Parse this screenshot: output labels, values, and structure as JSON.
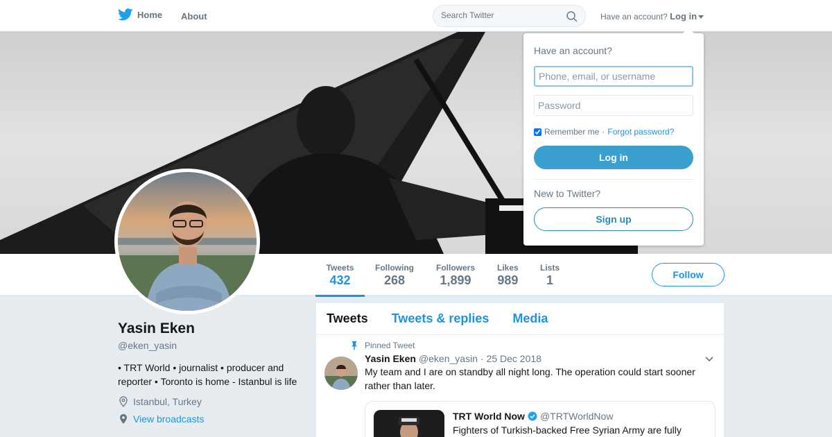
{
  "nav": {
    "home_label": "Home",
    "about_label": "About",
    "search_placeholder": "Search Twitter",
    "account_prompt": "Have an account?",
    "login_label": "Log in"
  },
  "profile_nav": {
    "stats": [
      {
        "label": "Tweets",
        "value": "432"
      },
      {
        "label": "Following",
        "value": "268"
      },
      {
        "label": "Followers",
        "value": "1,899"
      },
      {
        "label": "Likes",
        "value": "989"
      },
      {
        "label": "Lists",
        "value": "1"
      }
    ],
    "follow_label": "Follow"
  },
  "profile": {
    "name": "Yasin Eken",
    "handle": "@eken_yasin",
    "bio": "• TRT World • journalist • producer and reporter • Toronto is home - Istanbul is life",
    "location": "Istanbul, Turkey",
    "broadcasts_label": "View broadcasts"
  },
  "timeline": {
    "tabs": [
      "Tweets",
      "Tweets & replies",
      "Media"
    ],
    "pinned_label": "Pinned Tweet",
    "tweet": {
      "name": "Yasin Eken",
      "handle": "@eken_yasin",
      "date": "· 25 Dec 2018",
      "text": "My team and I are on standby all night long. The operation could start sooner rather than later."
    },
    "quote": {
      "name": "TRT World Now",
      "handle": "@TRTWorldNow",
      "text": "Fighters of Turkish-backed Free Syrian Army are fully"
    }
  },
  "login_dropdown": {
    "title": "Have an account?",
    "username_placeholder": "Phone, email, or username",
    "password_placeholder": "Password",
    "remember_label": "Remember me",
    "separator": "·",
    "forgot_label": "Forgot password?",
    "login_button": "Log in",
    "new_label": "New to Twitter?",
    "signup_button": "Sign up"
  },
  "colors": {
    "accent": "#1b95e0",
    "login_button": "#3aa0cf",
    "background": "#e6ecf0"
  }
}
